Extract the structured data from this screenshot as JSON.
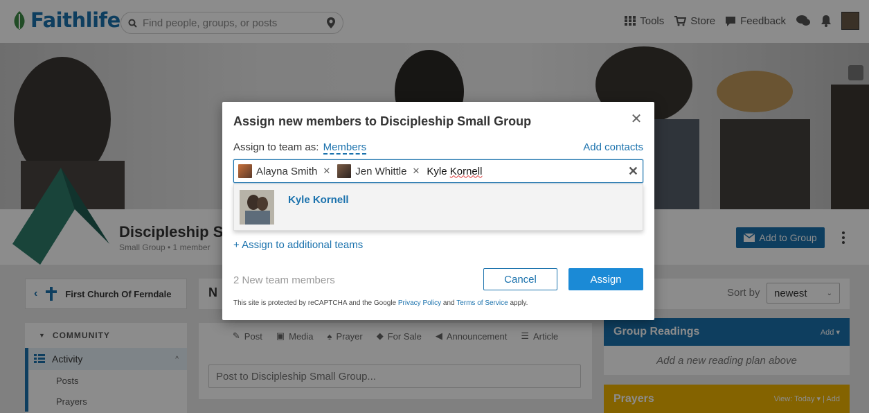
{
  "topbar": {
    "brand": "Faithlife",
    "search_placeholder": "Find people, groups, or posts",
    "tools": "Tools",
    "store": "Store",
    "feedback": "Feedback"
  },
  "group": {
    "title": "Discipleship Sm",
    "meta": "Small Group  •  1 member",
    "add_to_group": "Add to Group"
  },
  "sidebar": {
    "church": "First Church Of Ferndale",
    "section": "COMMUNITY",
    "active_item": "Activity",
    "sub_items": [
      "Posts",
      "Prayers"
    ]
  },
  "feed": {
    "title_initial": "N",
    "tabs": [
      "Post",
      "Media",
      "Prayer",
      "For Sale",
      "Announcement",
      "Article"
    ],
    "composer_placeholder": "Post to Discipleship Small Group..."
  },
  "right": {
    "sort_label": "Sort by",
    "sort_value": "newest",
    "readings_title": "Group Readings",
    "readings_add": "Add ▾",
    "readings_empty": "Add a new reading plan above",
    "prayers_title": "Prayers",
    "prayers_actions": "View: Today ▾ | Add"
  },
  "modal": {
    "title": "Assign new members to Discipleship Small Group",
    "assign_as_label": "Assign to team as:",
    "assign_as_role": "Members",
    "add_contacts": "Add contacts",
    "tokens": [
      "Alayna Smith",
      "Jen Whittle"
    ],
    "typed_text": "Kyle Kornell",
    "typed_prefix": "Kyle ",
    "typed_misspelled": "Kornell",
    "suggestion": "Kyle Kornell",
    "assign_more": "+ Assign to additional teams",
    "new_count": "2 New team members",
    "cancel": "Cancel",
    "assign": "Assign",
    "legal_prefix": "This site is protected by reCAPTCHA and the Google ",
    "privacy_link": "Privacy Policy",
    "legal_and": " and ",
    "terms_link": "Terms of Service",
    "legal_suffix": " apply."
  },
  "colors": {
    "brand_blue": "#1b72ad",
    "assign_blue": "#1b8ad6",
    "prayers_gold": "#f0b400"
  }
}
